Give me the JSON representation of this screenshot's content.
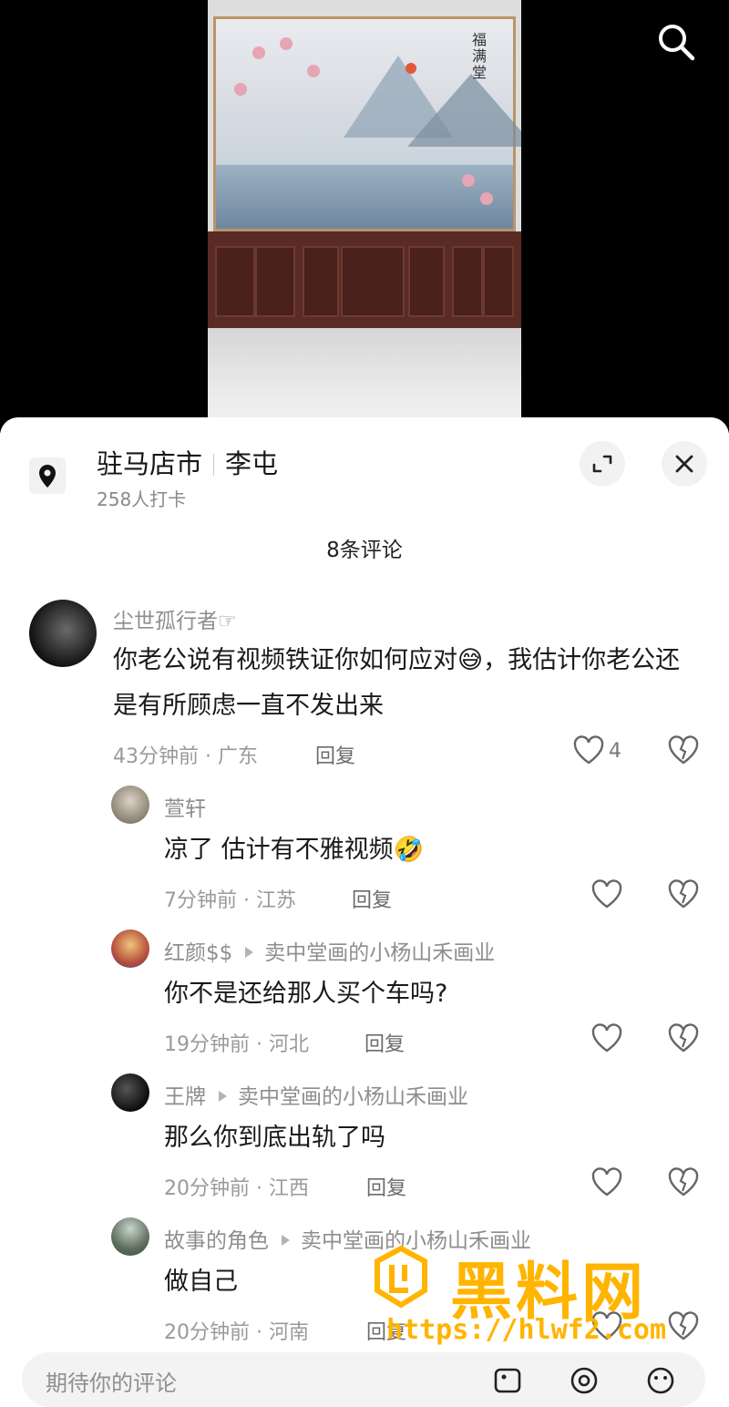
{
  "location": {
    "city": "驻马店市",
    "place": "李屯",
    "checkins": "258人打卡"
  },
  "comments_count": "8条评论",
  "comments": [
    {
      "user": "尘世孤行者☞",
      "text": "你老公说有视频铁证你如何应对😅，我估计你老公还是有所顾虑一直不发出来",
      "time_loc": "43分钟前 · 广东",
      "reply_label": "回复",
      "likes": "4"
    }
  ],
  "replies": [
    {
      "user": "萱轩",
      "target": "",
      "text": "凉了 估计有不雅视频🤣",
      "time_loc": "7分钟前 · 江苏",
      "reply_label": "回复"
    },
    {
      "user": "红颜$$",
      "target": "卖中堂画的小杨山禾画业",
      "text": "你不是还给那人买个车吗?",
      "time_loc": "19分钟前 · 河北",
      "reply_label": "回复"
    },
    {
      "user": "王牌",
      "target": "卖中堂画的小杨山禾画业",
      "text": "那么你到底出轨了吗",
      "time_loc": "20分钟前 · 江西",
      "reply_label": "回复"
    },
    {
      "user": "故事的角色",
      "target": "卖中堂画的小杨山禾画业",
      "text": "做自己",
      "time_loc": "20分钟前 · 河南",
      "reply_label": "回复"
    }
  ],
  "input": {
    "placeholder": "期待你的评论"
  },
  "painting_text": "福满堂",
  "watermark": {
    "text": "黑料网",
    "url": "https://hlwf2.com"
  },
  "colors": {
    "watermark": "#ffb400",
    "text_secondary": "#8e8e8e",
    "sheet_bg": "#ffffff",
    "video_bg": "#000000"
  },
  "icons": [
    "search-icon",
    "location-pin-icon",
    "expand-icon",
    "close-icon",
    "heart-icon",
    "broken-heart-icon",
    "image-icon",
    "at-icon",
    "emoji-icon"
  ]
}
